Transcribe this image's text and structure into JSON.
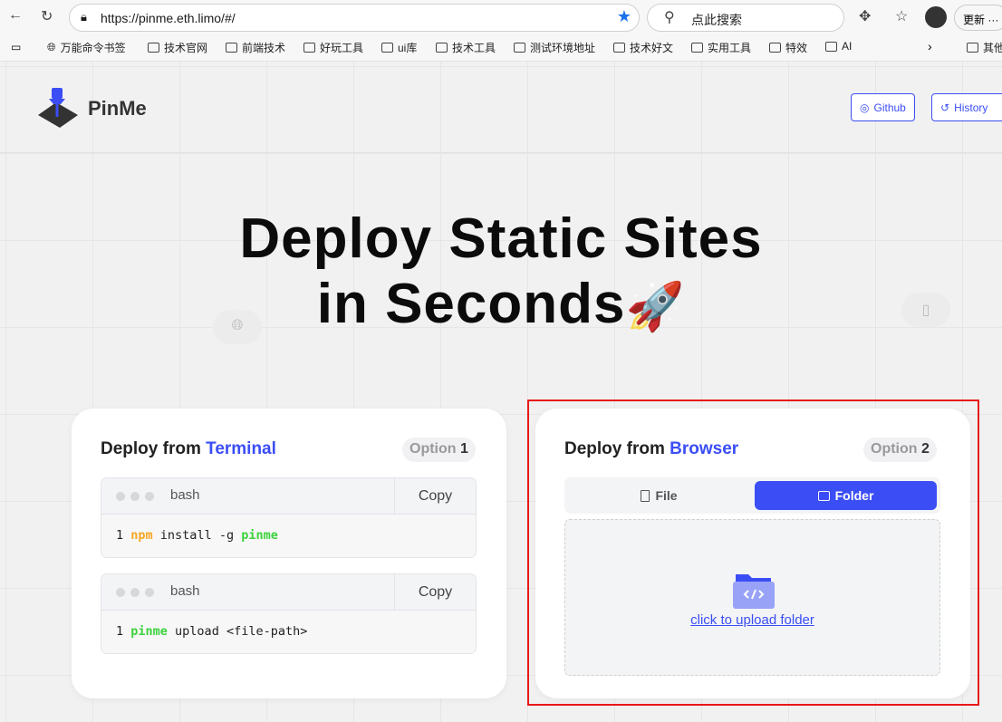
{
  "browser": {
    "url": "https://pinme.eth.limo/#/",
    "search_placeholder": "点此搜索",
    "update_label": "更新",
    "bookmarks": [
      "万能命令书签",
      "技术官网",
      "前端技术",
      "好玩工具",
      "ui库",
      "技术工具",
      "测试环境地址",
      "技术好文",
      "实用工具",
      "特效",
      "AI"
    ],
    "other_bookmarks": "其他"
  },
  "header": {
    "brand": "PinMe",
    "logo_text": "PINME",
    "github": "Github",
    "history": "History"
  },
  "hero": {
    "line1": "Deploy Static Sites",
    "line2": "in Seconds",
    "emoji": "🚀"
  },
  "terminal_card": {
    "prefix": "Deploy from ",
    "accent": "Terminal",
    "option": "Option",
    "option_num": "1",
    "blocks": [
      {
        "lang": "bash",
        "copy": "Copy",
        "line_no": "1",
        "tokens": [
          {
            "t": "npm",
            "c": "o"
          },
          {
            "t": " install -g ",
            "c": ""
          },
          {
            "t": "pinme",
            "c": "g"
          }
        ]
      },
      {
        "lang": "bash",
        "copy": "Copy",
        "line_no": "1",
        "tokens": [
          {
            "t": "pinme",
            "c": "g"
          },
          {
            "t": " upload <file-path>",
            "c": ""
          }
        ]
      }
    ]
  },
  "browser_card": {
    "prefix": "Deploy from ",
    "accent": "Browser",
    "option": "Option",
    "option_num": "2",
    "tabs": [
      {
        "label": "File",
        "active": false
      },
      {
        "label": "Folder",
        "active": true
      }
    ],
    "upload_link": "click to upload folder"
  },
  "colors": {
    "accent": "#3b4ef5",
    "highlight": "#e81919"
  }
}
